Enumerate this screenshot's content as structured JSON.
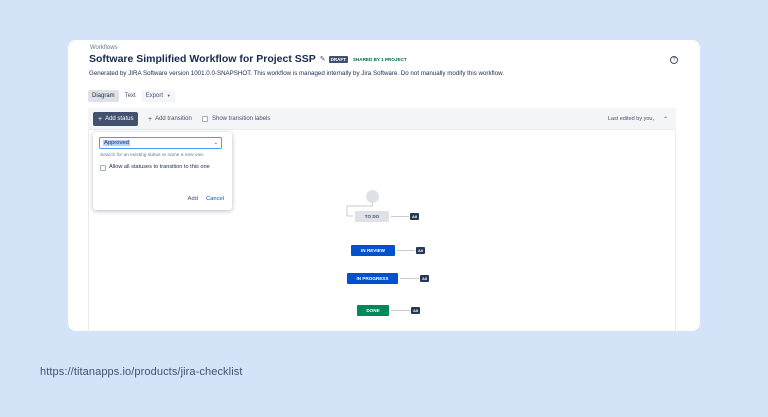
{
  "breadcrumb": "Workflows",
  "workflow": {
    "title": "Software Simplified Workflow for Project SSP",
    "status_lozenge": "DRAFT",
    "shared_text": "SHARED BY 1 PROJECT",
    "description": "Generated by JIRA Software version 1001.0.0-SNAPSHOT. This workflow is managed internally by Jira Software. Do not manually modify this workflow."
  },
  "tabs": {
    "diagram": "Diagram",
    "text": "Text",
    "export": "Export"
  },
  "toolbar": {
    "add_status": "Add status",
    "add_transition": "Add transition",
    "show_transition_labels": "Show transition labels",
    "last_edited": "Last edited by you,"
  },
  "add_status_popup": {
    "selected_value": "Approved",
    "hint": "Search for an existing status or name a new one.",
    "allow_all_label": "Allow all statuses to transition to this one",
    "add_label": "Add",
    "cancel_label": "Cancel"
  },
  "diagram": {
    "statuses": [
      {
        "label": "TO DO",
        "color": "#dfe1e6"
      },
      {
        "label": "IN REVIEW",
        "color": "#0052cc"
      },
      {
        "label": "IN PROGRESS",
        "color": "#0052cc"
      },
      {
        "label": "DONE",
        "color": "#00875a"
      }
    ],
    "all_label": "All"
  },
  "footer_url": "https://titanapps.io/products/jira-checklist",
  "colors": {
    "background": "#d5e3f8",
    "primary_button": "#42526e",
    "link": "#0052cc",
    "done": "#00875a"
  }
}
